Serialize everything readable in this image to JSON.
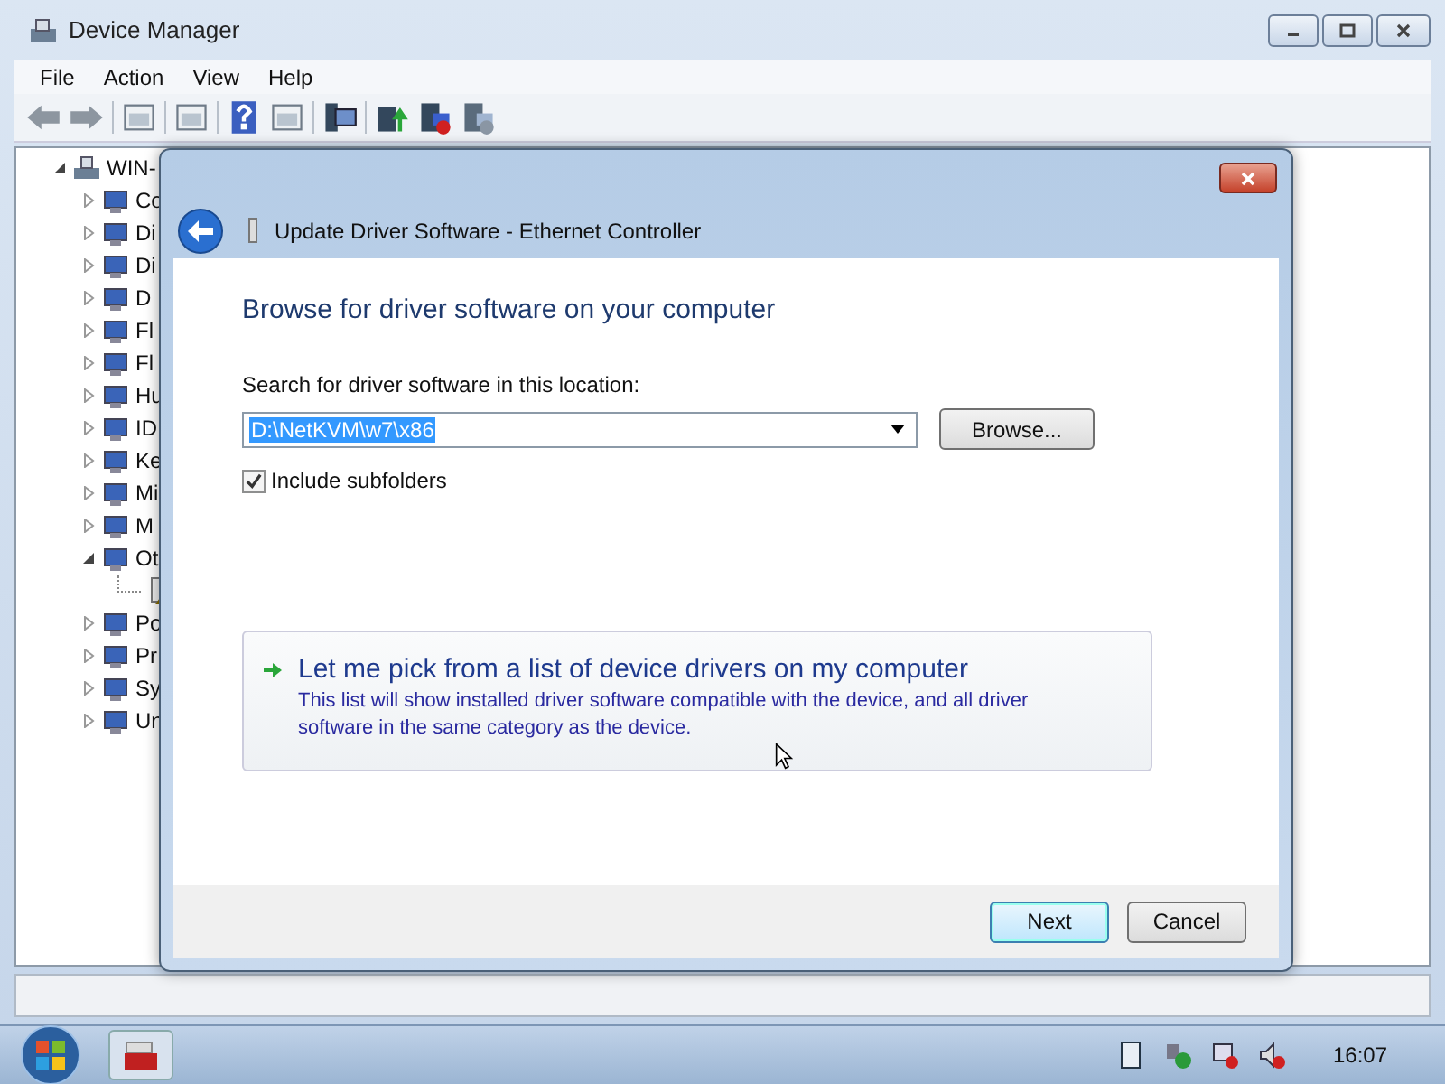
{
  "window": {
    "title": "Device Manager"
  },
  "menu": [
    {
      "label": "File"
    },
    {
      "label": "Action"
    },
    {
      "label": "View"
    },
    {
      "label": "Help"
    }
  ],
  "tree": {
    "label": "WIN-",
    "expanded": true,
    "children": [
      {
        "label": "Co",
        "kind": "group",
        "expanded": false
      },
      {
        "label": "Di",
        "kind": "group",
        "expanded": false
      },
      {
        "label": "Di",
        "kind": "group",
        "expanded": false
      },
      {
        "label": "D",
        "kind": "group",
        "expanded": false
      },
      {
        "label": "Fl",
        "kind": "group",
        "expanded": false
      },
      {
        "label": "Fl",
        "kind": "group",
        "expanded": false
      },
      {
        "label": "Hu",
        "kind": "group",
        "expanded": false
      },
      {
        "label": "ID",
        "kind": "group",
        "expanded": false
      },
      {
        "label": "Ke",
        "kind": "group",
        "expanded": false
      },
      {
        "label": "Mi",
        "kind": "group",
        "expanded": false
      },
      {
        "label": "M",
        "kind": "group",
        "expanded": false
      },
      {
        "label": "Ot",
        "kind": "group",
        "expanded": true,
        "children": [
          {
            "kind": "warning"
          }
        ]
      },
      {
        "label": "Po",
        "kind": "group",
        "expanded": false
      },
      {
        "label": "Pr",
        "kind": "group",
        "expanded": false
      },
      {
        "label": "Sy",
        "kind": "group",
        "expanded": false
      },
      {
        "label": "Un",
        "kind": "group",
        "expanded": false
      }
    ]
  },
  "dialog": {
    "title": "Update Driver Software - Ethernet Controller",
    "heading": "Browse for driver software on your computer",
    "location_label": "Search for driver software in this location:",
    "location": {
      "value": "D:\\NetKVM\\w7\\x86",
      "text_selected": true
    },
    "browse_button": "Browse...",
    "include_subfolders": {
      "label": "Include subfolders",
      "checked": true
    },
    "pick_option": {
      "title": "Let me pick from a list of device drivers on my computer",
      "description": "This list will show installed driver software compatible with the device, and all driver software in the same category as the device."
    },
    "buttons": [
      {
        "label": "Next",
        "default": true
      },
      {
        "label": "Cancel",
        "default": false
      }
    ]
  },
  "taskbar": {
    "clock": "16:07"
  }
}
